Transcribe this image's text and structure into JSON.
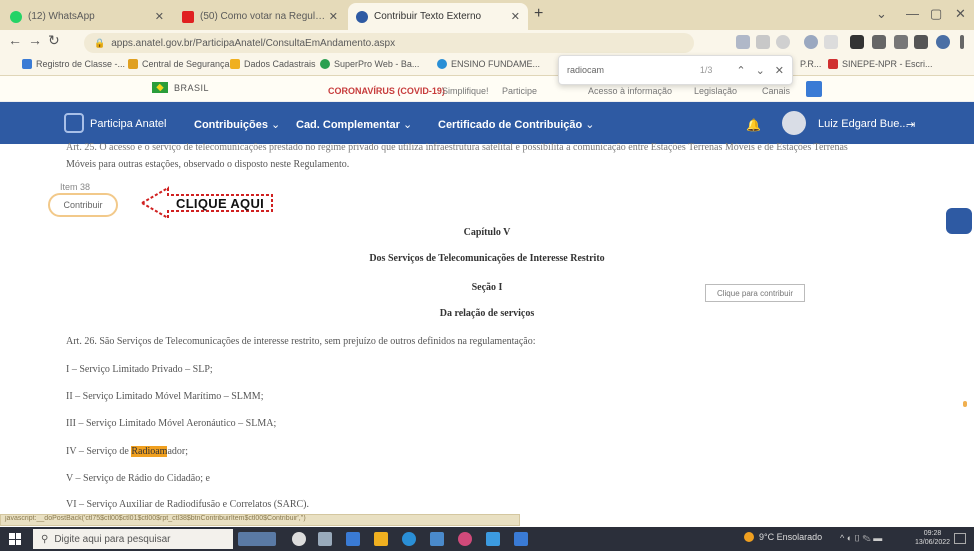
{
  "browser": {
    "tabs": [
      {
        "title": "(12) WhatsApp",
        "icon": "whatsapp-icon",
        "color": "#25d366"
      },
      {
        "title": "(50) Como votar na Regulamen...",
        "icon": "youtube-icon",
        "color": "#e02020"
      },
      {
        "title": "Contribuir Texto Externo",
        "icon": "anatel-icon",
        "color": "#2e5aa3"
      }
    ],
    "url": "apps.anatel.gov.br/ParticipaAnatel/ConsultaEmAndamento.aspx",
    "bookmarks": [
      {
        "label": "Registro de Classe -...",
        "color": "#3a7bd5"
      },
      {
        "label": "Central de Segurança",
        "color": "#e0a020"
      },
      {
        "label": "Dados Cadastrais",
        "color": "#f0b020"
      },
      {
        "label": "SuperPro Web - Ba...",
        "color": "#2aa050"
      },
      {
        "label": "ENSINO FUNDAME...",
        "color": "#2a8fd6"
      },
      {
        "label": "P.R...",
        "color": "#999999"
      },
      {
        "label": "SINEPE-NPR - Escri...",
        "color": "#d03030"
      }
    ],
    "find_bar": {
      "query": "radiocam",
      "count": "1/3"
    },
    "status_url": "javascript:__doPostBack('ctl75$ctl00$ctl01$ctl00$rpt_ctl38$btnContribuirItem$ctl00$Contribuir','')"
  },
  "gov_bar": {
    "brasil": "BRASIL",
    "links": [
      "CORONAVÍRUS (COVID-19)",
      "Simplifique!",
      "Participe",
      "Acesso à informação",
      "Legislação",
      "Canais"
    ]
  },
  "nav": {
    "brand": "Participa Anatel",
    "items": [
      "Contribuições",
      "Cad. Complementar",
      "Certificado de Contribuição"
    ],
    "user": "Luiz Edgard Bue..."
  },
  "content": {
    "partial_line_1": "Art. 25. O acesso e o serviço de telecomunicações prestado no regime privado que utiliza infraestrutura satelital e possibilita a comunicação entre Estações Terrenas Móveis e de Estações Terrenas",
    "partial_line_2": "Móveis para outras estações, observado o disposto neste Regulamento.",
    "item_label": "Item 38",
    "contribute_label": "Contribuir",
    "cta": "CLIQUE AQUI",
    "chapter": "Capítulo V",
    "chapter_title": "Dos Serviços de Telecomunicações de Interesse Restrito",
    "section": "Seção I",
    "section_title": "Da relação de serviços",
    "click_to_contribute": "Clique para contribuir",
    "art26": "Art. 26. São Serviços de Telecomunicações de interesse restrito, sem prejuízo de outros definidos na regulamentação:",
    "list": [
      "I – Serviço Limitado Privado – SLP;",
      "II – Serviço Limitado Móvel Marítimo – SLMM;",
      "III – Serviço Limitado Móvel Aeronáutico – SLMA;",
      "IV – Serviço de ",
      "V – Serviço de Rádio do Cidadão; e",
      "VI – Serviço Auxiliar de Radiodifusão e Correlatos (SARC)."
    ],
    "list_iv_highlight": "Radioam",
    "list_iv_rest": "ador;"
  },
  "taskbar": {
    "search_placeholder": "Digite aqui para pesquisar",
    "weather": "9°C Ensolarado",
    "time": "09:28",
    "date": "13/06/2022"
  }
}
